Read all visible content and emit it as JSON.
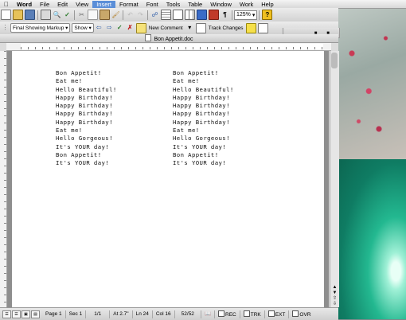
{
  "menubar": {
    "items": [
      "Word",
      "File",
      "Edit",
      "View",
      "Insert",
      "Format",
      "Font",
      "Tools",
      "Table",
      "Window",
      "Work",
      "Help"
    ],
    "selected": "Insert"
  },
  "toolbar": {
    "zoom": "125%",
    "markup_dropdown": "Final Showing Markup",
    "show_label": "Show",
    "new_comment_label": "New Comment",
    "track_changes_label": "Track Changes"
  },
  "window": {
    "title": "Bon Appetit.doc"
  },
  "document": {
    "left_column": [
      "Bon Appetit!",
      "Eat me!",
      "Hello Beautiful!",
      "Happy Birthday!",
      "Happy Birthday!",
      "Happy Birthday!",
      "Happy Birthday!",
      "Eat me!",
      "Hello Gorgeous!",
      "It's YOUR day!",
      "Bon Appetit!",
      "It's YOUR day!"
    ],
    "right_column": [
      "Bon Appetit!",
      "Eat me!",
      "Hello Beautiful!",
      "Happy Birthday!",
      "Happy Birthday!",
      "Happy Birthday!",
      "Happy Birthday!",
      "Eat me!",
      "Hello Gorgeous!",
      "It's YOUR day!",
      "Bon Appetit!",
      "It's YOUR day!"
    ]
  },
  "status": {
    "page": "Page 1",
    "sec": "Sec 1",
    "pages": "1/1",
    "at": "At 2.7\"",
    "ln": "Ln 24",
    "col": "Col 16",
    "words": "52/52",
    "rec": "REC",
    "trk": "TRK",
    "ext": "EXT",
    "ovr": "OVR"
  }
}
